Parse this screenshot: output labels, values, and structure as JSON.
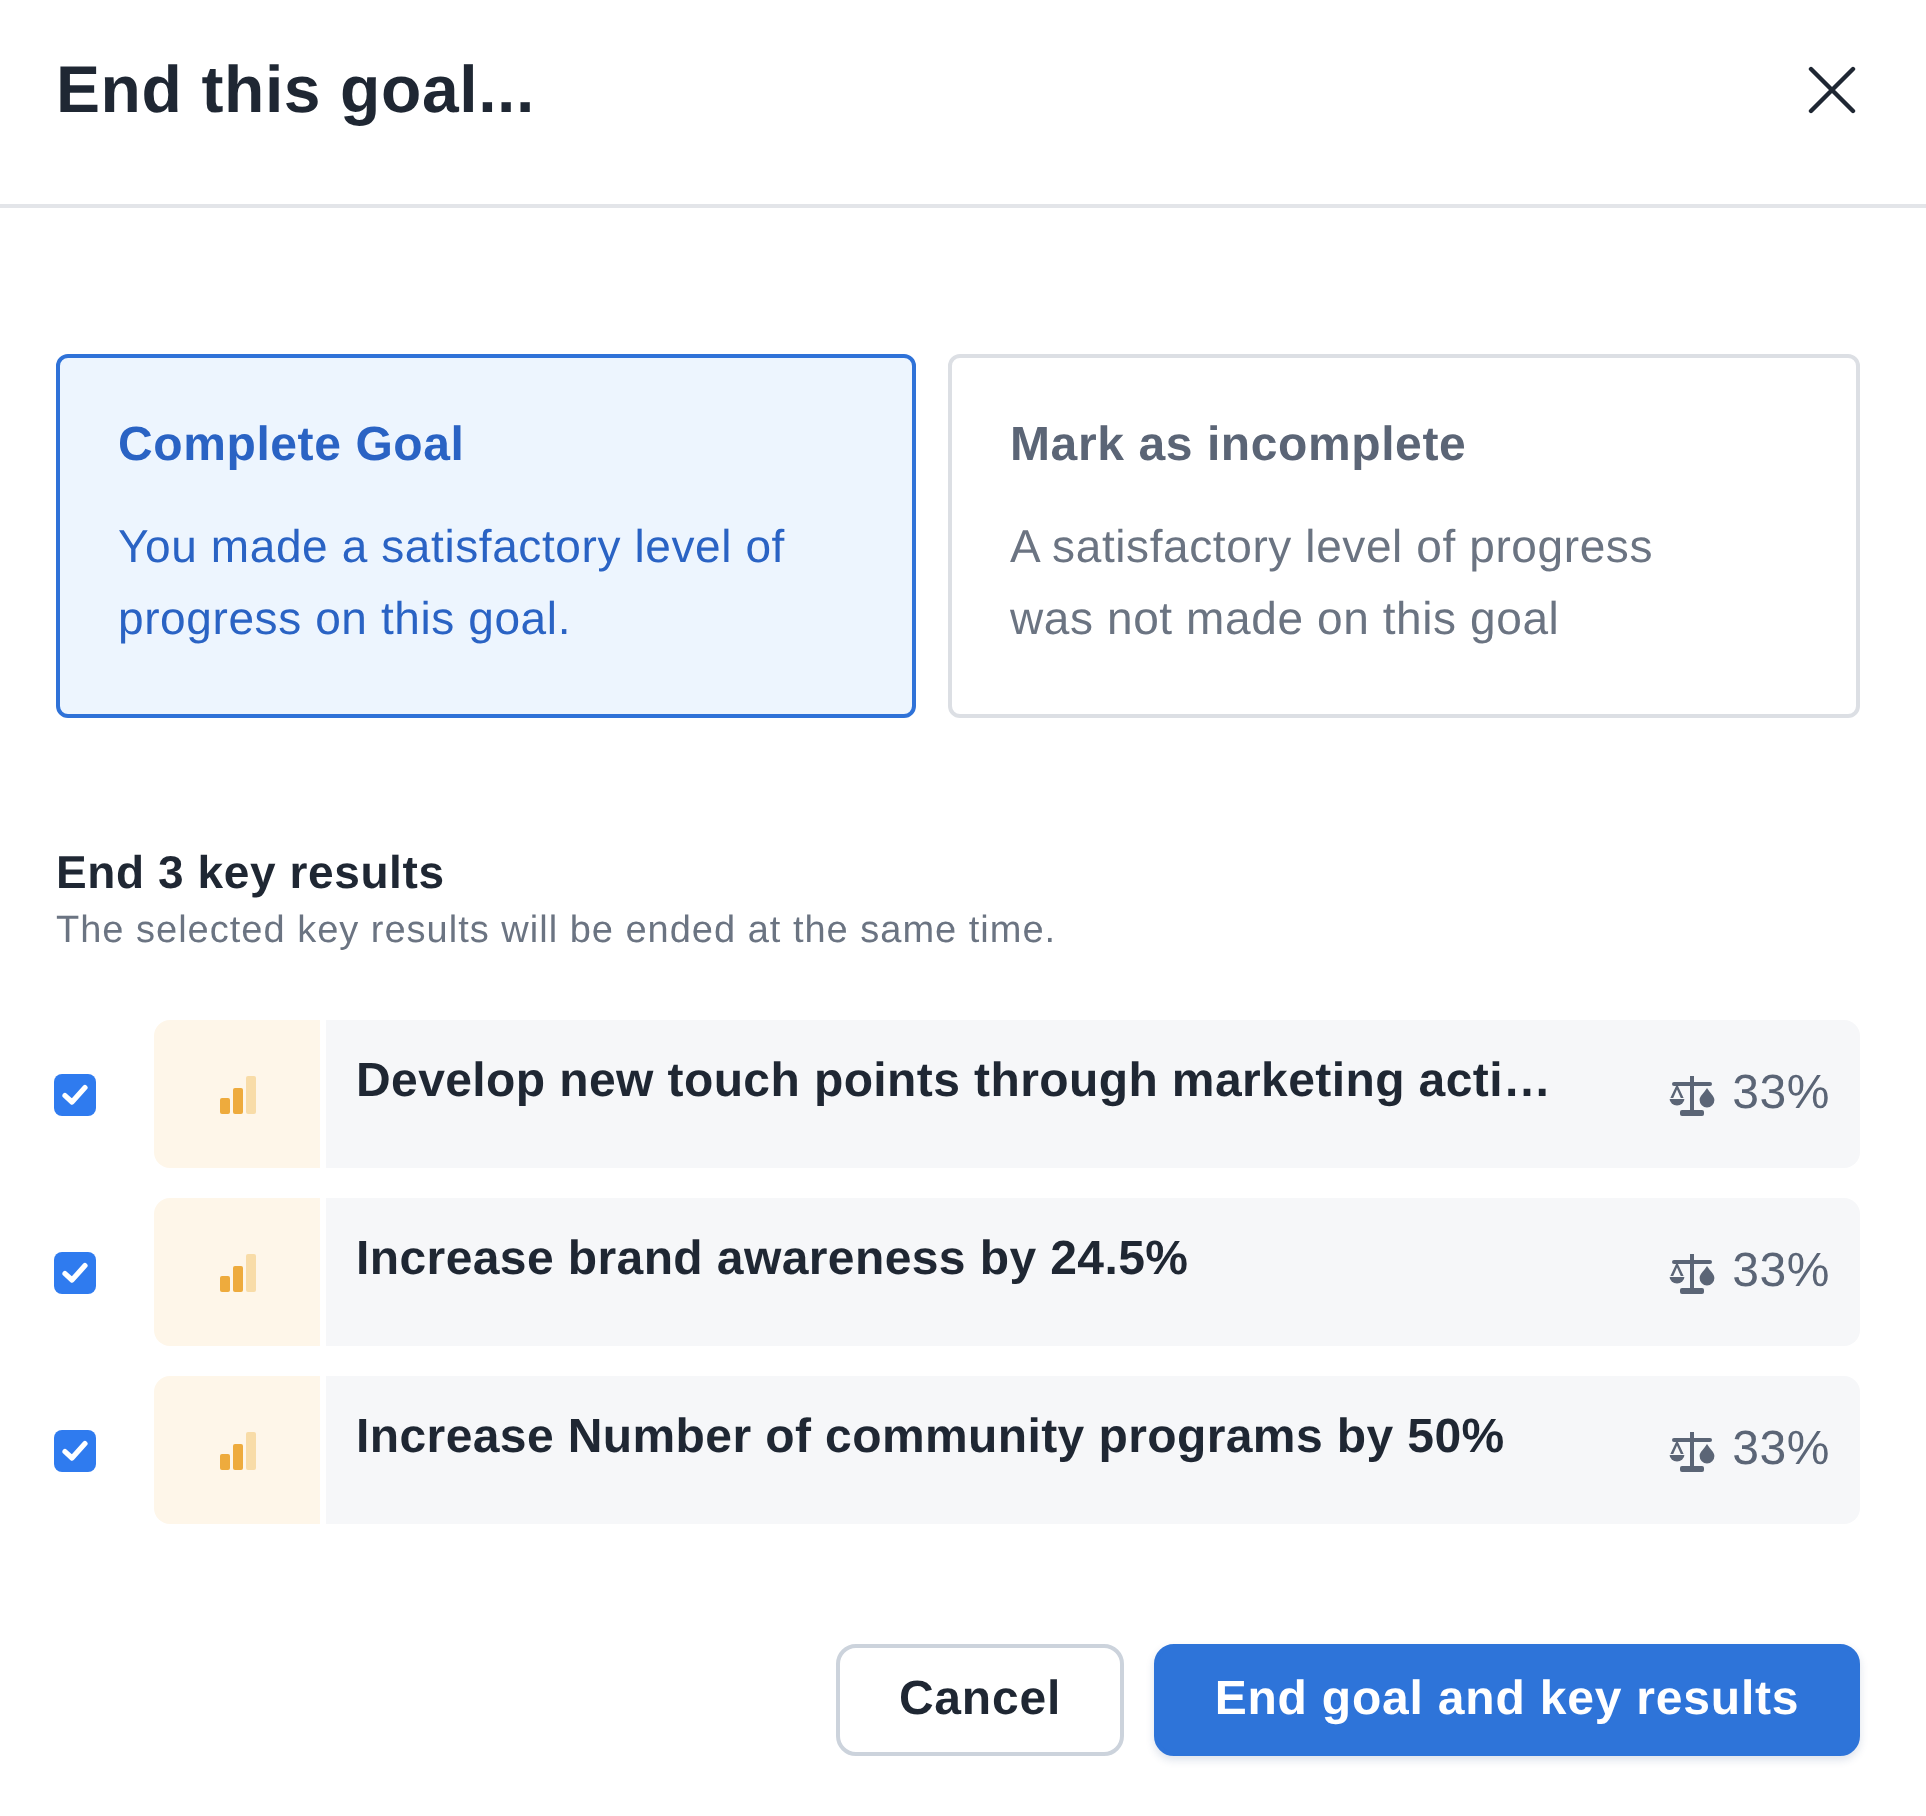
{
  "dialog": {
    "title": "End this goal..."
  },
  "options": [
    {
      "title": "Complete Goal",
      "description": "You made a satisfactory level of progress on this goal.",
      "selected": true
    },
    {
      "title": "Mark as incomplete",
      "description": "A satisfactory level of progress was not made on this goal",
      "selected": false
    }
  ],
  "key_results_section": {
    "heading": "End 3 key results",
    "subtitle": "The selected key results will be ended at the same time."
  },
  "key_results": [
    {
      "title": "Develop new touch points through marketing acti…",
      "checked": true,
      "weight": "33%"
    },
    {
      "title": "Increase brand awareness by 24.5%",
      "checked": true,
      "weight": "33%"
    },
    {
      "title": "Increase Number of community programs by 50%",
      "checked": true,
      "weight": "33%"
    }
  ],
  "buttons": [
    {
      "label": "Cancel",
      "kind": "secondary"
    },
    {
      "label": "End goal and key results",
      "kind": "primary"
    }
  ]
}
